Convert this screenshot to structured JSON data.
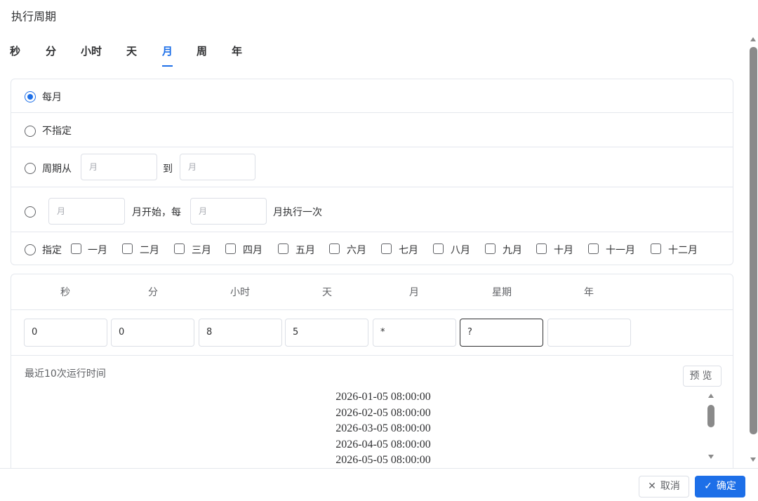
{
  "title": "执行周期",
  "tabs": [
    "秒",
    "分",
    "小时",
    "天",
    "月",
    "周",
    "年"
  ],
  "active_tab": "月",
  "options": {
    "every_month": "每月",
    "unspecified": "不指定",
    "range_from": "周期从",
    "range_to": "到",
    "range_placeholder": "月",
    "start_placeholder": "月",
    "start_text": "月开始，每",
    "interval_placeholder": "月",
    "interval_text": "月执行一次",
    "specify": "指定",
    "months": [
      "一月",
      "二月",
      "三月",
      "四月",
      "五月",
      "六月",
      "七月",
      "八月",
      "九月",
      "十月",
      "十一月",
      "十二月"
    ]
  },
  "expression": {
    "headers": [
      "秒",
      "分",
      "小时",
      "天",
      "月",
      "星期",
      "年"
    ],
    "values": [
      "0",
      "0",
      "8",
      "5",
      "*",
      "?",
      ""
    ]
  },
  "recent": {
    "label": "最近10次运行时间",
    "preview_label": "预览",
    "times": [
      "2026-01-05 08:00:00",
      "2026-02-05 08:00:00",
      "2026-03-05 08:00:00",
      "2026-04-05 08:00:00",
      "2026-05-05 08:00:00"
    ]
  },
  "footer": {
    "cancel_label": "取消",
    "ok_label": "确定"
  },
  "colors": {
    "accent": "#1d6fe8",
    "border": "#e4e7ed"
  },
  "icons": {
    "cancel": "close-icon",
    "ok": "check-icon"
  }
}
